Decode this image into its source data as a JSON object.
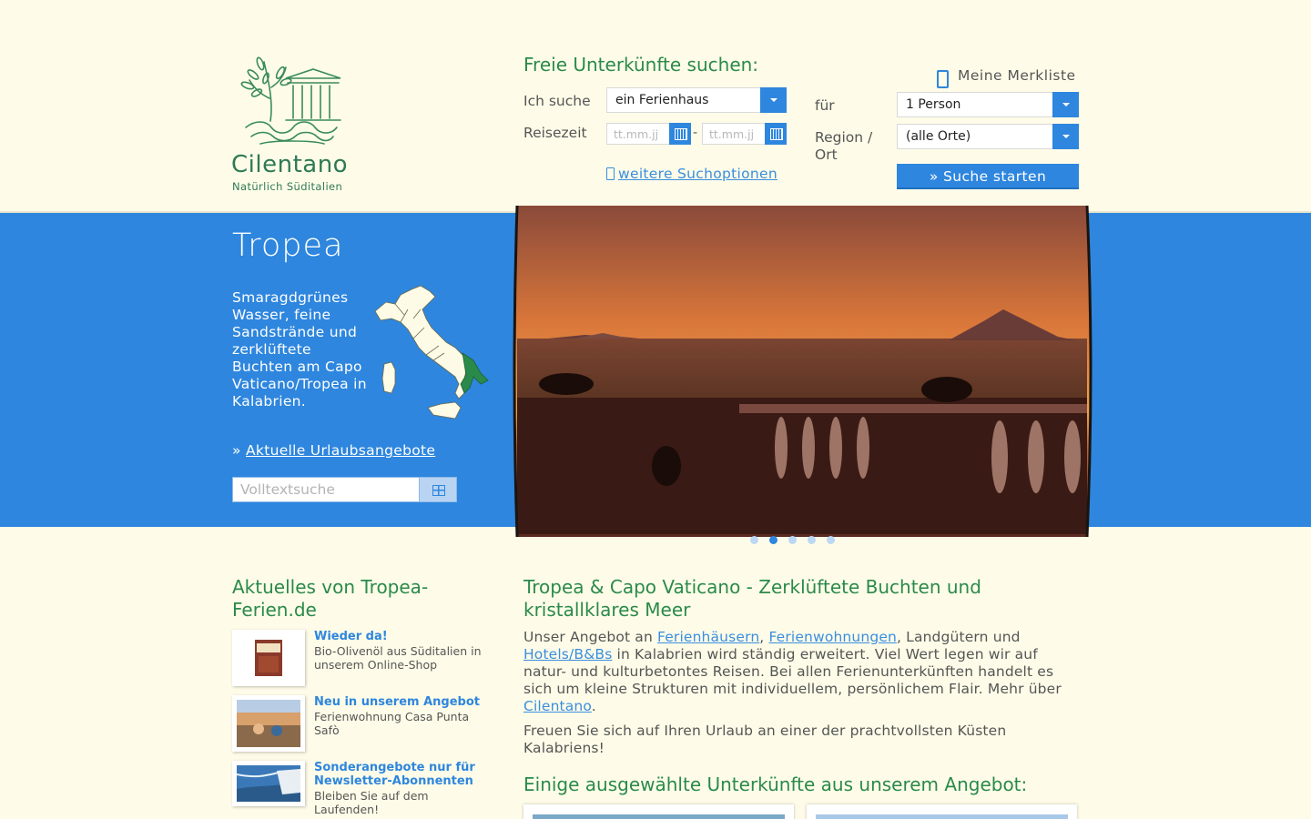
{
  "brand": {
    "name": "Cilentano",
    "tagline": "Natürlich Süditalien"
  },
  "search": {
    "title": "Freie Unterkünfte suchen:",
    "type_label": "Ich suche",
    "type_value": "ein Ferienhaus",
    "period_label": "Reisezeit",
    "date_from_placeholder": "tt.mm.jj",
    "date_to_placeholder": "tt.mm.jj",
    "date_separator": "-",
    "more_options": "weitere Suchoptionen",
    "persons_label": "für",
    "persons_value": "1 Person",
    "region_label": "Region / Ort",
    "region_value": "(alle Orte)",
    "submit": "» Suche starten"
  },
  "wishlist": {
    "label": "Meine Merkliste",
    "icon": "bookmark-icon"
  },
  "hero": {
    "title": "Tropea",
    "text": "Smaragdgrünes Wasser, feine Sandstrände und zerklüftete Buchten am Capo Vaticano/Tropea in Kalabrien.",
    "link_prefix": "» ",
    "link": "Aktuelle Urlaubsangebote",
    "fulltext_placeholder": "Volltextsuche",
    "slides": {
      "count": 5,
      "active": 2
    }
  },
  "news": {
    "title": "Aktuelles von Tropea-Ferien.de",
    "items": [
      {
        "head": "Wieder da!",
        "body": "Bio-Olivenöl aus Süditalien in unserem Online-Shop"
      },
      {
        "head": "Neu in unserem Angebot",
        "body": "Ferienwohnung Casa Punta Safò"
      },
      {
        "head": "Sonderangebote nur für Newsletter-Abonnenten",
        "body": "Bleiben Sie auf dem Laufenden!"
      }
    ]
  },
  "main": {
    "title": "Tropea & Capo Vaticano - Zerklüftete Buchten und kristallklares Meer",
    "p1_a": "Unser Angebot an ",
    "p1_link1": "Ferienhäusern",
    "p1_b": ", ",
    "p1_link2": "Ferienwohnungen",
    "p1_c": ", Landgütern und ",
    "p1_link3": "Hotels/B&Bs",
    "p1_d": " in Kalabrien wird ständig erweitert. Viel Wert legen wir auf natur- und kulturbetontes Reisen. Bei allen Ferienunterkünften handelt es sich um kleine Strukturen mit individuellem, persönlichem Flair. Mehr über ",
    "p1_link4": "Cilentano",
    "p1_e": ".",
    "p2": "Freuen Sie sich auf Ihren Urlaub an einer der prachtvollsten Küsten Kalabriens!",
    "offers_title": "Einige ausgewählte Unterkünfte aus unserem Angebot:"
  },
  "colors": {
    "accent": "#2e86de",
    "headline_green": "#2a8a4a",
    "background": "#fefce8"
  }
}
